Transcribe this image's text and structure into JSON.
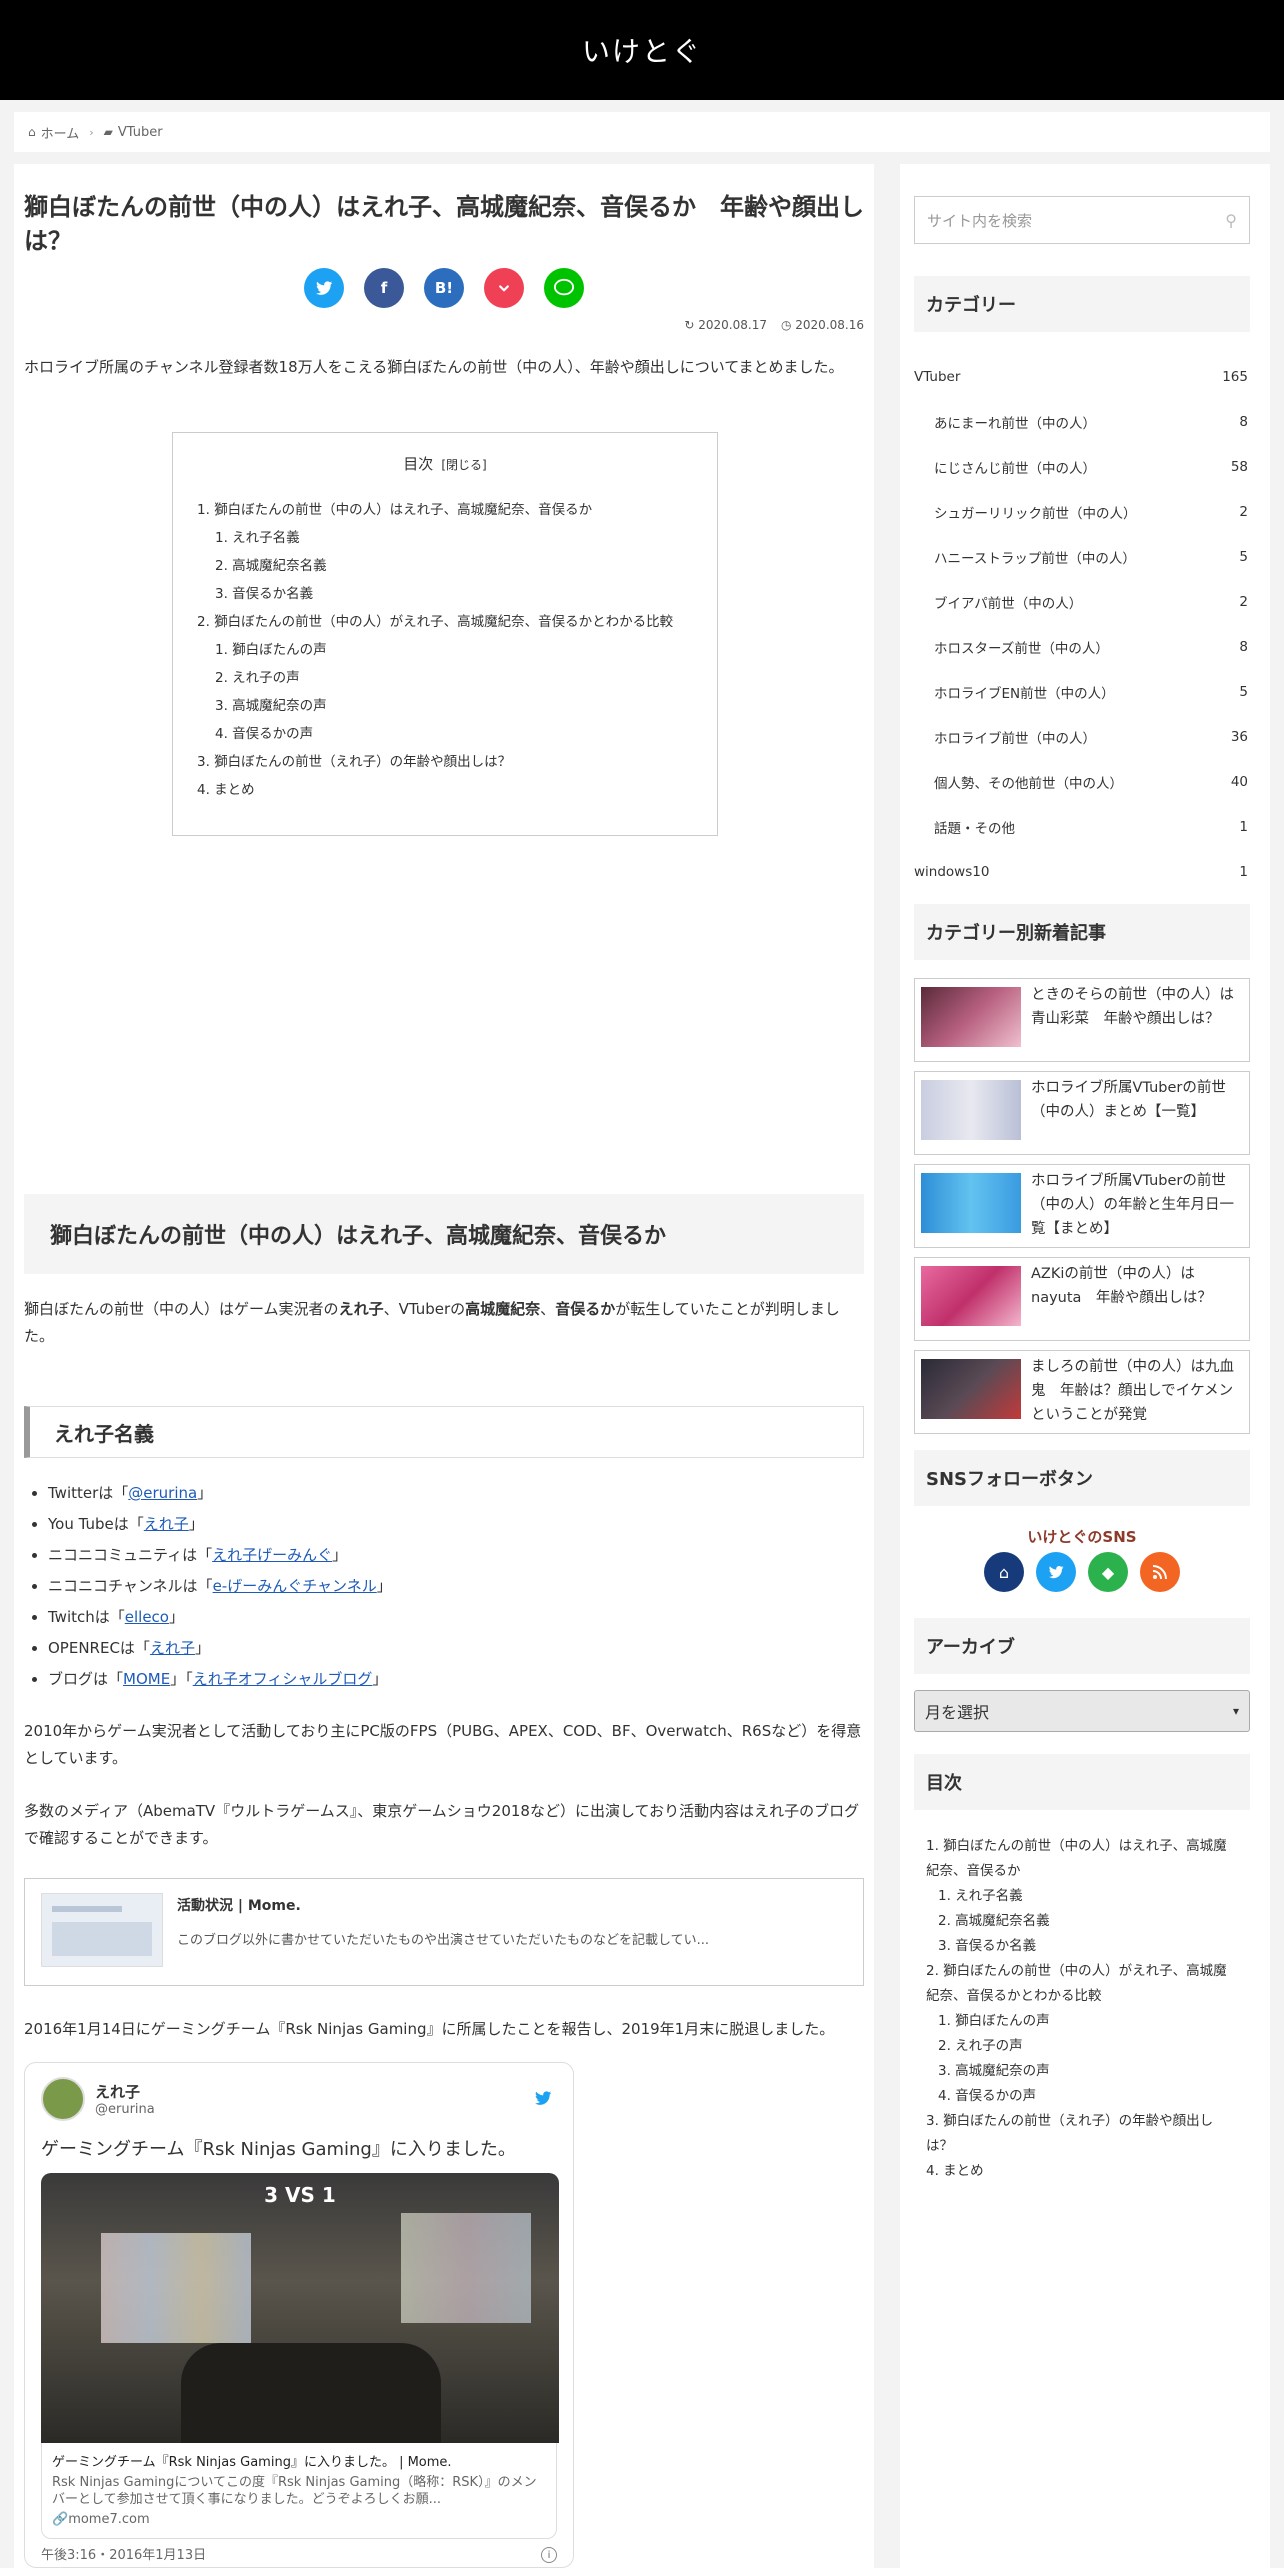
{
  "site": {
    "title": "いけとぐ"
  },
  "breadcrumb": {
    "home": "ホーム",
    "category": "VTuber"
  },
  "article": {
    "title": "獅白ぼたんの前世（中の人）はえれ子、高城魔紀奈、音俣るか　年齢や顔出しは？",
    "updated": "2020.08.17",
    "published": "2020.08.16",
    "intro": "ホロライブ所属のチャンネル登録者数18万人をこえる獅白ぼたんの前世（中の人）、年齢や顔出しについてまとめました。",
    "share": [
      "twitter",
      "facebook",
      "hatena",
      "pocket",
      "line"
    ],
    "share_labels": {
      "hatena": "B!"
    },
    "toc": {
      "title": "目次",
      "toggle": "[閉じる]",
      "items": [
        "1. 獅白ぼたんの前世（中の人）はえれ子、高城魔紀奈、音俣るか",
        "1. えれ子名義",
        "2. 高城魔紀奈名義",
        "3. 音俣るか名義",
        "2. 獅白ぼたんの前世（中の人）がえれ子、高城魔紀奈、音俣るかとわかる比較",
        "1. 獅白ぼたんの声",
        "2. えれ子の声",
        "3. 高城魔紀奈の声",
        "4. 音俣るかの声",
        "3. 獅白ぼたんの前世（えれ子）の年齢や顔出しは？",
        "4. まとめ"
      ]
    },
    "h2": "獅白ぼたんの前世（中の人）はえれ子、高城魔紀奈、音俣るか",
    "p1": {
      "a": "獅白ぼたんの前世（中の人）はゲーム実況者の",
      "b": "えれ子",
      "c": "、VTuberの",
      "d": "高城魔紀奈",
      "e": "、",
      "f": "音俣るか",
      "g": "が転生していたことが判明しました。"
    },
    "h3": "えれ子名義",
    "links": [
      {
        "pre": "Twitterは「",
        "link": "@erurina",
        "post": "」"
      },
      {
        "pre": "You Tubeは「",
        "link": "えれ子",
        "post": "」"
      },
      {
        "pre": "ニコニコミュニティは「",
        "link": "えれ子げーみんぐ",
        "post": "」"
      },
      {
        "pre": "ニコニコチャンネルは「",
        "link": "e-げーみんぐチャンネル",
        "post": "」"
      },
      {
        "pre": "Twitchは「",
        "link": "elleco",
        "post": "」"
      },
      {
        "pre": "OPENRECは「",
        "link": "えれ子",
        "post": "」"
      }
    ],
    "blog": {
      "pre": "ブログは「",
      "link1": "MOME",
      "mid": "」「",
      "link2": "えれ子オフィシャルブログ",
      "post": "」"
    },
    "p2": "2010年からゲーム実況者として活動しており主にPC版のFPS（PUBG、APEX、COD、BF、Overwatch、R6Sなど）を得意としています。",
    "p3": "多数のメディア（AbemaTV『ウルトラゲームス』、東京ゲームショウ2018など）に出演しており活動内容はえれ子のブログで確認することができます。",
    "card": {
      "title": "活動状況 | Mome.",
      "desc": "このブログ以外に書かせていただいたものや出演させていただいたものなどを記載してい..."
    },
    "p4": "2016年1月14日にゲーミングチーム『Rsk Ninjas Gaming』に所属したことを報告し、2019年1月末に脱退しました。",
    "tweet": {
      "name": "えれ子",
      "handle": "@erurina",
      "text": "ゲーミングチーム『Rsk Ninjas Gaming』に入りました。",
      "hud": "3 VS 1",
      "card_title": "ゲーミングチーム『Rsk Ninjas Gaming』に入りました。 | Mome.",
      "card_desc": "Rsk Ninjas Gamingについてこの度『Rsk Ninjas Gaming（略称：RSK）』のメンバーとして参加させて頂く事になりました。どうぞよろしくお願...",
      "card_url": "mome7.com",
      "time": "午後3:16・2016年1月13日"
    }
  },
  "sidebar": {
    "search_placeholder": "サイト内を検索",
    "categories_title": "カテゴリー",
    "categories": [
      {
        "name": "VTuber",
        "count": "165",
        "sub": false
      },
      {
        "name": "あにまーれ前世（中の人）",
        "count": "8",
        "sub": true
      },
      {
        "name": "にじさんじ前世（中の人）",
        "count": "58",
        "sub": true
      },
      {
        "name": "シュガーリリック前世（中の人）",
        "count": "2",
        "sub": true
      },
      {
        "name": "ハニーストラップ前世（中の人）",
        "count": "5",
        "sub": true
      },
      {
        "name": "ブイアパ前世（中の人）",
        "count": "2",
        "sub": true
      },
      {
        "name": "ホロスターズ前世（中の人）",
        "count": "8",
        "sub": true
      },
      {
        "name": "ホロライブEN前世（中の人）",
        "count": "5",
        "sub": true
      },
      {
        "name": "ホロライブ前世（中の人）",
        "count": "36",
        "sub": true
      },
      {
        "name": "個人勢、その他前世（中の人）",
        "count": "40",
        "sub": true
      },
      {
        "name": "話題・その他",
        "count": "1",
        "sub": true
      },
      {
        "name": "windows10",
        "count": "1",
        "sub": false
      }
    ],
    "news_title": "カテゴリー別新着記事",
    "news": [
      {
        "title": "ときのそらの前世（中の人）は青山彩菜　年齢や顔出しは？",
        "color": "#7a3b5a"
      },
      {
        "title": "ホロライブ所属VTuberの前世（中の人）まとめ【一覧】",
        "color": "#d9dbe6"
      },
      {
        "title": "ホロライブ所属VTuberの前世（中の人）の年齢と生年月日一覧【まとめ】",
        "color": "#49a7e0"
      },
      {
        "title": "AZKiの前世（中の人）はnayuta　年齢や顔出しは？",
        "color": "#c8407a"
      },
      {
        "title": "ましろの前世（中の人）は九血鬼　年齢は？顔出しでイケメンということが発覚",
        "color": "#3a3a4a"
      }
    ],
    "sns_title": "SNSフォローボタン",
    "sns_label": "いけとぐのSNS",
    "sns": [
      {
        "icon": "home-icon",
        "color": "#173a7a"
      },
      {
        "icon": "twitter-icon",
        "color": "#1da1f2"
      },
      {
        "icon": "feedly-icon",
        "color": "#2bb24c"
      },
      {
        "icon": "rss-icon",
        "color": "#f26522"
      }
    ],
    "archive_title": "アーカイブ",
    "archive_select": "月を選択",
    "toc_title": "目次",
    "toc": [
      {
        "t": "1. 獅白ぼたんの前世（中の人）はえれ子、高城魔紀奈、音俣るか",
        "sub": false
      },
      {
        "t": "1. えれ子名義",
        "sub": true
      },
      {
        "t": "2. 高城魔紀奈名義",
        "sub": true
      },
      {
        "t": "3. 音俣るか名義",
        "sub": true
      },
      {
        "t": "2. 獅白ぼたんの前世（中の人）がえれ子、高城魔紀奈、音俣るかとわかる比較",
        "sub": false
      },
      {
        "t": "1. 獅白ぼたんの声",
        "sub": true
      },
      {
        "t": "2. えれ子の声",
        "sub": true
      },
      {
        "t": "3. 高城魔紀奈の声",
        "sub": true
      },
      {
        "t": "4. 音俣るかの声",
        "sub": true
      },
      {
        "t": "3. 獅白ぼたんの前世（えれ子）の年齢や顔出しは？",
        "sub": false
      },
      {
        "t": "4. まとめ",
        "sub": false
      }
    ]
  }
}
